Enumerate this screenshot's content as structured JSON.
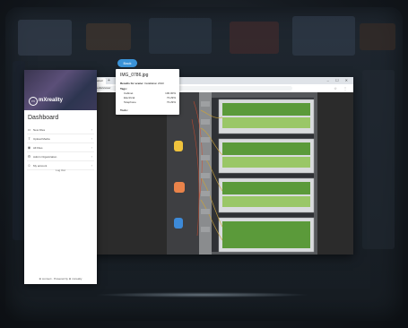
{
  "back_pill": "Back",
  "app": {
    "brand": "mXreality",
    "logo_glyph": "m",
    "dashboard_title": "Dashboard",
    "menu": [
      {
        "icon": "file-icon",
        "glyph": "▭",
        "label": "New Files"
      },
      {
        "icon": "upload-icon",
        "glyph": "⇪",
        "label": "Upload Media"
      },
      {
        "icon": "eye-icon",
        "glyph": "◉",
        "label": "All Files"
      },
      {
        "icon": "organize-icon",
        "glyph": "⚙",
        "label": "Admin Organization"
      },
      {
        "icon": "account-icon",
        "glyph": "☺",
        "label": "My account"
      }
    ],
    "logout_label": "Log Out",
    "footer": "⊕ connect · Powered by ⊕ mxrealty"
  },
  "browser": {
    "tab_title": "Y · Navigate · Mxreality · Shared",
    "new_tab_glyph": "+",
    "window_controls": "–  ☐  ✕",
    "nav_glyphs": "←  →  ↻",
    "url": "mxreality.io/media/viewer",
    "toolbar_glyphs": "☆  ⋮"
  },
  "popup": {
    "file_name": "IMG_0786.jpg",
    "results_label": "Results for scene:",
    "results_value": "Installation 2013",
    "tags_label": "Tags:",
    "tags": [
      {
        "name": "Cabinet",
        "pct": "100.00%"
      },
      {
        "name": "Electrical",
        "pct": "73.29%"
      },
      {
        "name": "Telephone",
        "pct": "73.29%"
      }
    ],
    "tools_label": "Tools:"
  }
}
